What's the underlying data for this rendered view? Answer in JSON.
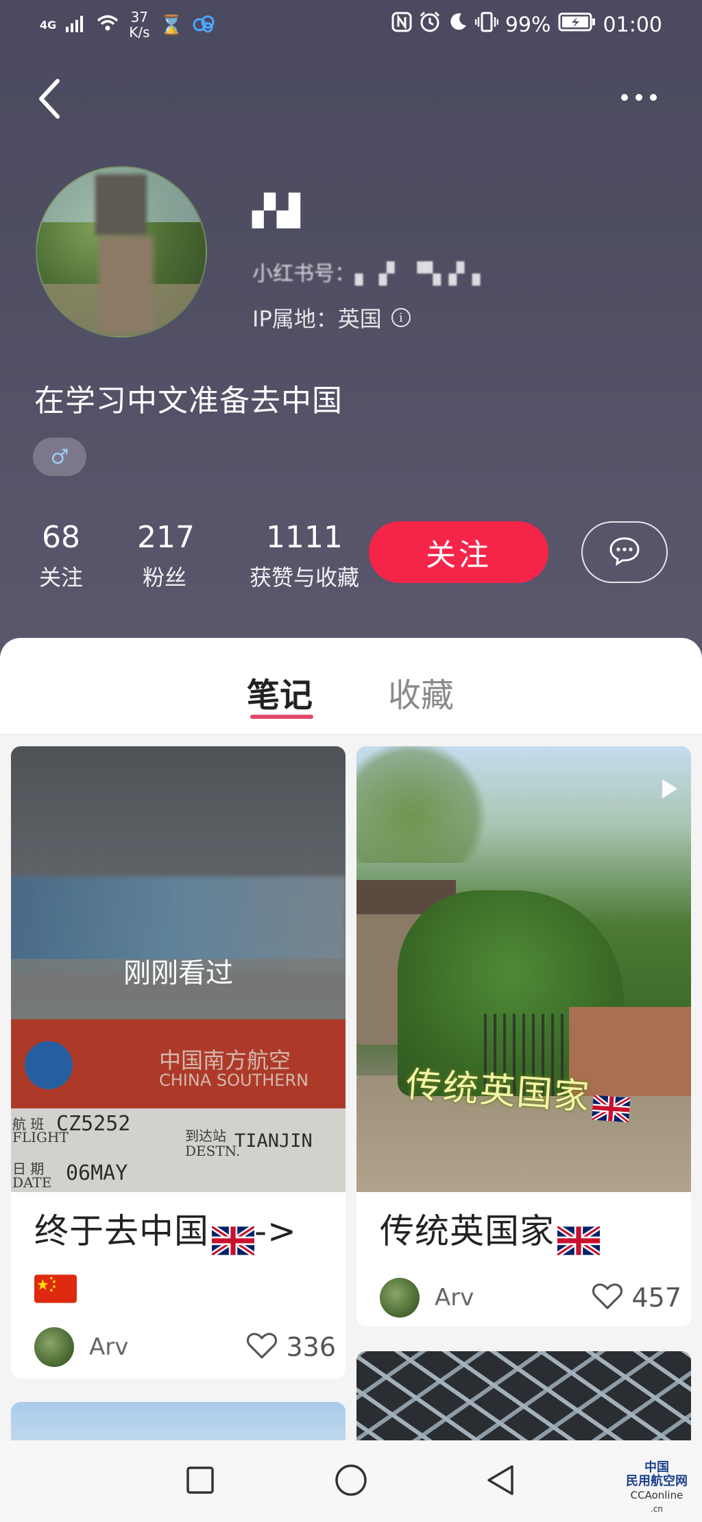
{
  "status_bar": {
    "network": "4G",
    "speed_value": "37",
    "speed_unit": "K/s",
    "battery": "99%",
    "time": "01:00"
  },
  "profile": {
    "username": "▞▟",
    "user_id": "小红书号：▖▗▘ ▝▚▗▘▖",
    "ip_location": "IP属地：英国",
    "bio": "在学习中文准备去中国",
    "gender_symbol": "♂",
    "stats": [
      {
        "value": "68",
        "label": "关注"
      },
      {
        "value": "217",
        "label": "粉丝"
      },
      {
        "value": "1111",
        "label": "获赞与收藏"
      }
    ],
    "follow_label": "关注"
  },
  "tabs": [
    {
      "label": "笔记",
      "active": true
    },
    {
      "label": "收藏",
      "active": false
    }
  ],
  "notes": [
    {
      "title_prefix": "终于去中国",
      "title_arrow": "->",
      "overlay_label": "刚刚看过",
      "author": "Arv",
      "likes": "336",
      "cover": {
        "airline_cn": "中国南方航空",
        "airline_en": "CHINA SOUTHERN",
        "flight_label_cn": "航 班",
        "flight_label_en": "FLIGHT",
        "flight_no": "CZ5252",
        "dest_label_cn": "到达站",
        "dest_label_en": "DESTN.",
        "destination": "TIANJIN",
        "date_label_cn": "日 期",
        "date_label_en": "DATE",
        "date": "06MAY"
      }
    },
    {
      "title": "传统英国家",
      "overlay_text": "传统英国家",
      "author": "Arv",
      "likes": "457"
    }
  ],
  "watermark": {
    "line1": "中国",
    "line2": "民用航空网",
    "line3": "CCAonline",
    "line4": ".cn"
  },
  "colors": {
    "accent": "#f5254a",
    "header_bg": "#4f4e63",
    "tab_indicator": "#e24867"
  }
}
